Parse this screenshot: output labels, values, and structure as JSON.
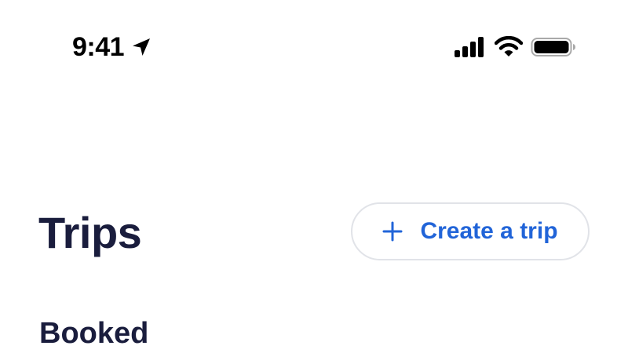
{
  "status_bar": {
    "time": "9:41",
    "icons": [
      "location-arrow-icon",
      "cellular-signal-icon",
      "wifi-icon",
      "battery-icon"
    ]
  },
  "header": {
    "title": "Trips",
    "create_button": {
      "icon": "plus-icon",
      "label": "Create a trip"
    }
  },
  "sections": {
    "booked_heading": "Booked"
  },
  "colors": {
    "title": "#1a1d3d",
    "accent": "#2164d8",
    "button_border": "#e1e3e8",
    "status_foreground": "#000000",
    "background": "#ffffff"
  }
}
